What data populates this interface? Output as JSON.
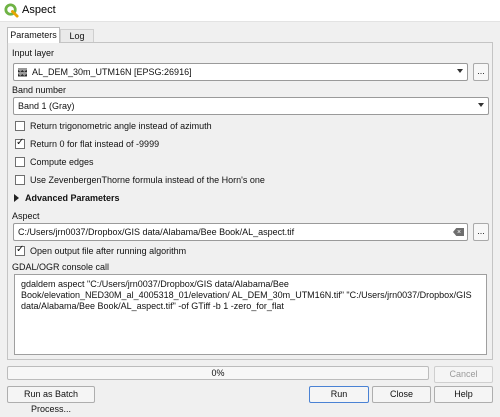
{
  "window": {
    "title": "Aspect",
    "icon": "qgis-icon"
  },
  "tabs": [
    {
      "label": "Parameters",
      "active": true
    },
    {
      "label": "Log",
      "active": false
    }
  ],
  "params": {
    "input_layer": {
      "label": "Input layer",
      "value": "AL_DEM_30m_UTM16N [EPSG:26916]",
      "icon": "raster-layer-icon",
      "browse_label": "..."
    },
    "band_number": {
      "label": "Band number",
      "value": "Band 1 (Gray)"
    },
    "checkboxes": [
      {
        "label": "Return trigonometric angle instead of azimuth",
        "checked": false
      },
      {
        "label": "Return 0 for flat instead of -9999",
        "checked": true
      },
      {
        "label": "Compute edges",
        "checked": false
      },
      {
        "label": "Use ZevenbergenThorne formula instead of the Horn's one",
        "checked": false
      }
    ],
    "advanced": {
      "label": "Advanced Parameters",
      "expanded": false
    },
    "aspect": {
      "label": "Aspect",
      "value": "C:/Users/jrn0037/Dropbox/GIS data/Alabama/Bee Book/AL_aspect.tif",
      "browse_label": "..."
    },
    "open_output": {
      "label": "Open output file after running algorithm",
      "checked": true
    },
    "console": {
      "label": "GDAL/OGR console call",
      "text": "gdaldem aspect \"C:/Users/jrn0037/Dropbox/GIS data/Alabama/Bee Book/elevation_NED30M_al_4005318_01/elevation/ AL_DEM_30m_UTM16N.tif\" \"C:/Users/jrn0037/Dropbox/GIS data/Alabama/Bee Book/AL_aspect.tif\" -of GTiff -b 1 -zero_for_flat"
    }
  },
  "progress": {
    "value": 0,
    "text": "0%"
  },
  "buttons": {
    "cancel": "Cancel",
    "batch": "Run as Batch Process...",
    "run": "Run",
    "close": "Close",
    "help": "Help"
  },
  "colors": {
    "accent": "#4a82d4",
    "qgis_green": "#6fb345"
  }
}
